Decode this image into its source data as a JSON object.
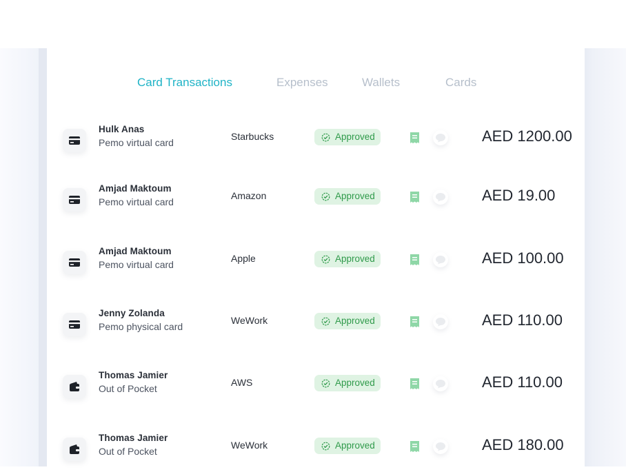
{
  "tabs": [
    {
      "label": "Card Transactions",
      "active": true
    },
    {
      "label": "Expenses",
      "active": false
    },
    {
      "label": "Wallets",
      "active": false
    },
    {
      "label": "Cards",
      "active": false
    }
  ],
  "colors": {
    "accent": "#1fb3c6",
    "inactive_tab": "#b6bfcb",
    "approved_bg": "#dff3e3",
    "approved_text": "#2f9a4a",
    "receipt_icon": "#8fd7a7"
  },
  "transactions": [
    {
      "name": "Hulk Anas",
      "source": "Pemo virtual card",
      "source_icon": "credit-card-icon",
      "merchant": "Starbucks",
      "status": "Approved",
      "amount": "AED 1200.00"
    },
    {
      "name": "Amjad Maktoum",
      "source": "Pemo virtual card",
      "source_icon": "credit-card-icon",
      "merchant": "Amazon",
      "status": "Approved",
      "amount": "AED 19.00"
    },
    {
      "name": "Amjad Maktoum",
      "source": "Pemo virtual card",
      "source_icon": "credit-card-icon",
      "merchant": "Apple",
      "status": "Approved",
      "amount": "AED 100.00"
    },
    {
      "name": "Jenny Zolanda",
      "source": "Pemo physical card",
      "source_icon": "credit-card-icon",
      "merchant": "WeWork",
      "status": "Approved",
      "amount": "AED 110.00"
    },
    {
      "name": "Thomas Jamier",
      "source": "Out of Pocket",
      "source_icon": "wallet-icon",
      "merchant": "AWS",
      "status": "Approved",
      "amount": "AED 110.00"
    },
    {
      "name": "Thomas Jamier",
      "source": "Out of Pocket",
      "source_icon": "wallet-icon",
      "merchant": "WeWork",
      "status": "Approved",
      "amount": "AED 180.00"
    }
  ]
}
